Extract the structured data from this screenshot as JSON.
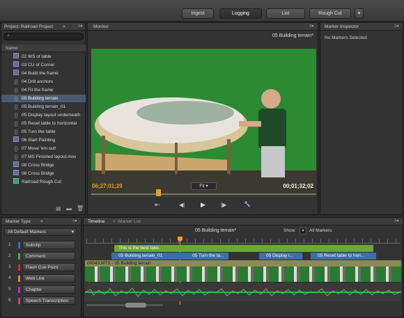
{
  "toolbar": {
    "buttons": [
      {
        "label": "Ingest"
      },
      {
        "label": "Logging"
      },
      {
        "label": "List"
      },
      {
        "label": "Rough Cut"
      }
    ],
    "more": "▾"
  },
  "project": {
    "tab": "Project: Railroad Project",
    "close": "×",
    "column_header": "Name",
    "items": [
      {
        "label": "02 WS of table",
        "type": "clip"
      },
      {
        "label": "03 CU of Corner",
        "type": "clip"
      },
      {
        "label": "04 Build the frame",
        "type": "clip"
      },
      {
        "label": "04 Drill anchors",
        "type": "subclip"
      },
      {
        "label": "04 Fit the frame",
        "type": "subclip"
      },
      {
        "label": "05 Building terrain",
        "type": "subclip",
        "selected": true
      },
      {
        "label": "05 Building terrain_01",
        "type": "subclip"
      },
      {
        "label": "05 Display layout underneath",
        "type": "subclip"
      },
      {
        "label": "05 Reset table to horizontal",
        "type": "subclip"
      },
      {
        "label": "05 Turn the table",
        "type": "subclip"
      },
      {
        "label": "06 Start Painting",
        "type": "clip"
      },
      {
        "label": "07 Move 'em out!",
        "type": "subclip"
      },
      {
        "label": "07 MS Finished layout.mov",
        "type": "subclip"
      },
      {
        "label": "08 Cross Bridge",
        "type": "clip"
      },
      {
        "label": "08 Cross Bridge",
        "type": "clip"
      },
      {
        "label": "Railroad Rough Cut",
        "type": "sequence"
      }
    ]
  },
  "monitor": {
    "tab": "Monitor",
    "clip_name": "05 Building terrain*",
    "timecode_in": "06;27;01;29",
    "timecode_duration": "00;01;32;02",
    "zoom": "Fit",
    "controls": {
      "in_out": "⇤",
      "step_back": "◀|",
      "play": "▶",
      "step_fwd": "|▶",
      "settings": "🔧"
    }
  },
  "inspector": {
    "tab": "Marker Inspector",
    "status": "No Markers Selected"
  },
  "marker_type": {
    "tab": "Marker Type",
    "filter": "All Default Markers",
    "items": [
      {
        "num": "1",
        "label": "Subclip",
        "color": "#3a6fd8"
      },
      {
        "num": "2",
        "label": "Comment",
        "color": "#3cae3c"
      },
      {
        "num": "3",
        "label": "Flash Cue Point",
        "color": "#c83232"
      },
      {
        "num": "4",
        "label": "Web Link",
        "color": "#e0892a"
      },
      {
        "num": "5",
        "label": "Chapter",
        "color": "#b03ab0"
      },
      {
        "num": "6",
        "label": "Speech Transcription",
        "color": "#d23b7a"
      }
    ]
  },
  "timeline": {
    "tab_timeline": "Timeline",
    "tab_markers": "Marker List",
    "title": "05 Building terrain*",
    "show_label": "Show:",
    "show_value": "All Markers",
    "comment": "This is the best take.",
    "subclips": [
      {
        "label": "05 Building terrain_01"
      },
      {
        "label": "05 Turn the ta..."
      },
      {
        "label": "05 Display l..."
      },
      {
        "label": "05 Reset table to hori..."
      }
    ],
    "track_label": "00043.MTS - 05 Building terrain"
  }
}
